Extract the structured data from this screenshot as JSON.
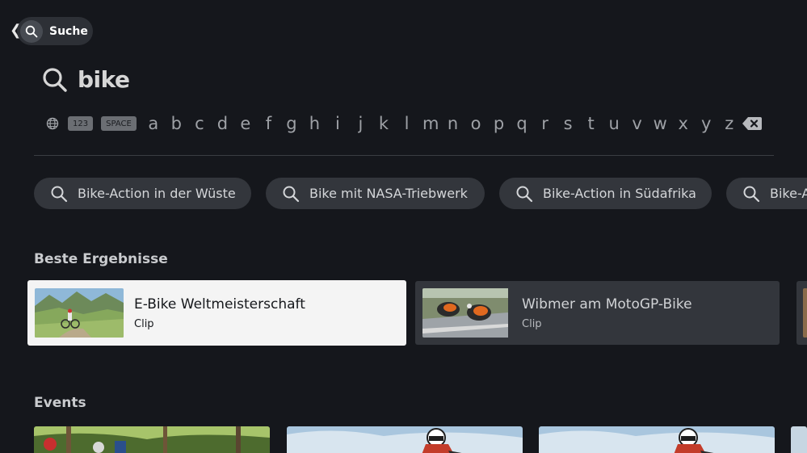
{
  "header": {
    "back_glyph": "❮",
    "search_pill_label": "Suche",
    "search_icon": "search-icon"
  },
  "query": {
    "text": "bike"
  },
  "keyboard": {
    "globe_icon": "globe-icon",
    "numbers_key": "123",
    "space_key": "SPACE",
    "letters": [
      "a",
      "b",
      "c",
      "d",
      "e",
      "f",
      "g",
      "h",
      "i",
      "j",
      "k",
      "l",
      "m",
      "n",
      "o",
      "p",
      "q",
      "r",
      "s",
      "t",
      "u",
      "v",
      "w",
      "x",
      "y",
      "z"
    ],
    "backspace_icon": "backspace-icon"
  },
  "suggestions": [
    {
      "label": "Bike-Action in der Wüste"
    },
    {
      "label": "Bike mit NASA-Triebwerk"
    },
    {
      "label": "Bike-Action in Südafrika"
    },
    {
      "label": "Bike-A"
    }
  ],
  "best_results": {
    "title": "Beste Ergebnisse",
    "items": [
      {
        "title": "E-Bike Weltmeisterschaft",
        "type": "Clip"
      },
      {
        "title": "Wibmer am MotoGP-Bike",
        "type": "Clip"
      }
    ]
  },
  "events": {
    "title": "Events"
  },
  "colors": {
    "background": "#15171c",
    "chip_bg": "#33363c",
    "focused_card": "#f4f4f4"
  }
}
